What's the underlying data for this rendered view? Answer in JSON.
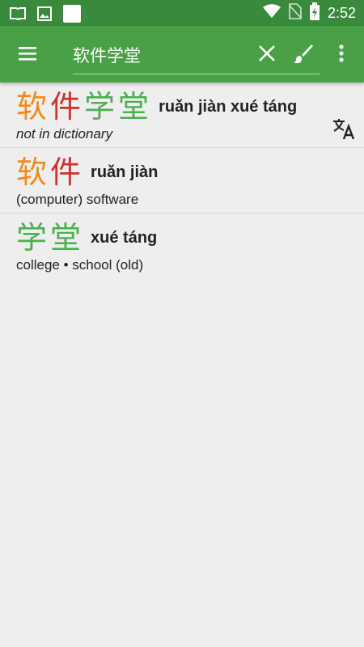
{
  "status_bar": {
    "time": "2:52",
    "icons": [
      "book-notification-icon",
      "image-notification-icon",
      "white-square-icon",
      "wifi-icon",
      "no-sim-icon",
      "battery-charging-icon"
    ]
  },
  "toolbar": {
    "menu_icon": "hamburger-menu-icon",
    "search_value": "软件学堂",
    "clear_icon": "clear-x-icon",
    "handwriting_icon": "brush-icon",
    "overflow_icon": "more-vert-icon"
  },
  "colors": {
    "status_bar": "#3a8a3c",
    "toolbar": "#4aa046",
    "background": "#eeeeee",
    "tone_orange": "#f08a1c",
    "tone_red": "#d32f2f",
    "tone_green": "#4caf50"
  },
  "results": [
    {
      "chars": [
        {
          "c": "软",
          "color": "#f08a1c"
        },
        {
          "c": "件",
          "color": "#d32f2f"
        },
        {
          "c": "学",
          "color": "#4caf50"
        },
        {
          "c": "堂",
          "color": "#4caf50"
        }
      ],
      "pinyin": "ruǎn jiàn xué táng",
      "definition": "not in dictionary",
      "action_icon": "translate-icon"
    },
    {
      "chars": [
        {
          "c": "软",
          "color": "#f08a1c"
        },
        {
          "c": "件",
          "color": "#d32f2f"
        }
      ],
      "pinyin": "ruǎn jiàn",
      "definition": "(computer) software"
    },
    {
      "chars": [
        {
          "c": "学",
          "color": "#4caf50"
        },
        {
          "c": "堂",
          "color": "#4caf50"
        }
      ],
      "pinyin": "xué táng",
      "definition": "college • school (old)"
    }
  ]
}
